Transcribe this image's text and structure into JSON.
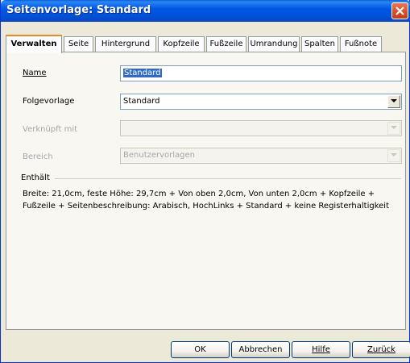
{
  "window": {
    "title": "Seitenvorlage: Standard"
  },
  "tabs": [
    {
      "label": "Verwalten",
      "active": true
    },
    {
      "label": "Seite"
    },
    {
      "label": "Hintergrund"
    },
    {
      "label": "Kopfzeile"
    },
    {
      "label": "Fußzeile"
    },
    {
      "label": "Umrandung"
    },
    {
      "label": "Spalten"
    },
    {
      "label": "Fußnote"
    }
  ],
  "form": {
    "name_label": "Name",
    "name_value": "Standard",
    "folge_label": "Folgevorlage",
    "folge_value": "Standard",
    "verknuepft_label": "Verknüpft mit",
    "verknuepft_value": "",
    "bereich_label": "Bereich",
    "bereich_value": "Benutzervorlagen"
  },
  "contains": {
    "label": "Enthält",
    "line1": "Breite: 21,0cm, feste Höhe: 29,7cm + Von oben 2,0cm, Von unten 2,0cm + Kopfzeile +",
    "line2": "Fußzeile + Seitenbeschreibung: Arabisch, HochLinks + Standard + keine Registerhaltigkeit"
  },
  "buttons": {
    "ok": "OK",
    "cancel": "Abbrechen",
    "help": "Hilfe",
    "back": "Zurück"
  }
}
